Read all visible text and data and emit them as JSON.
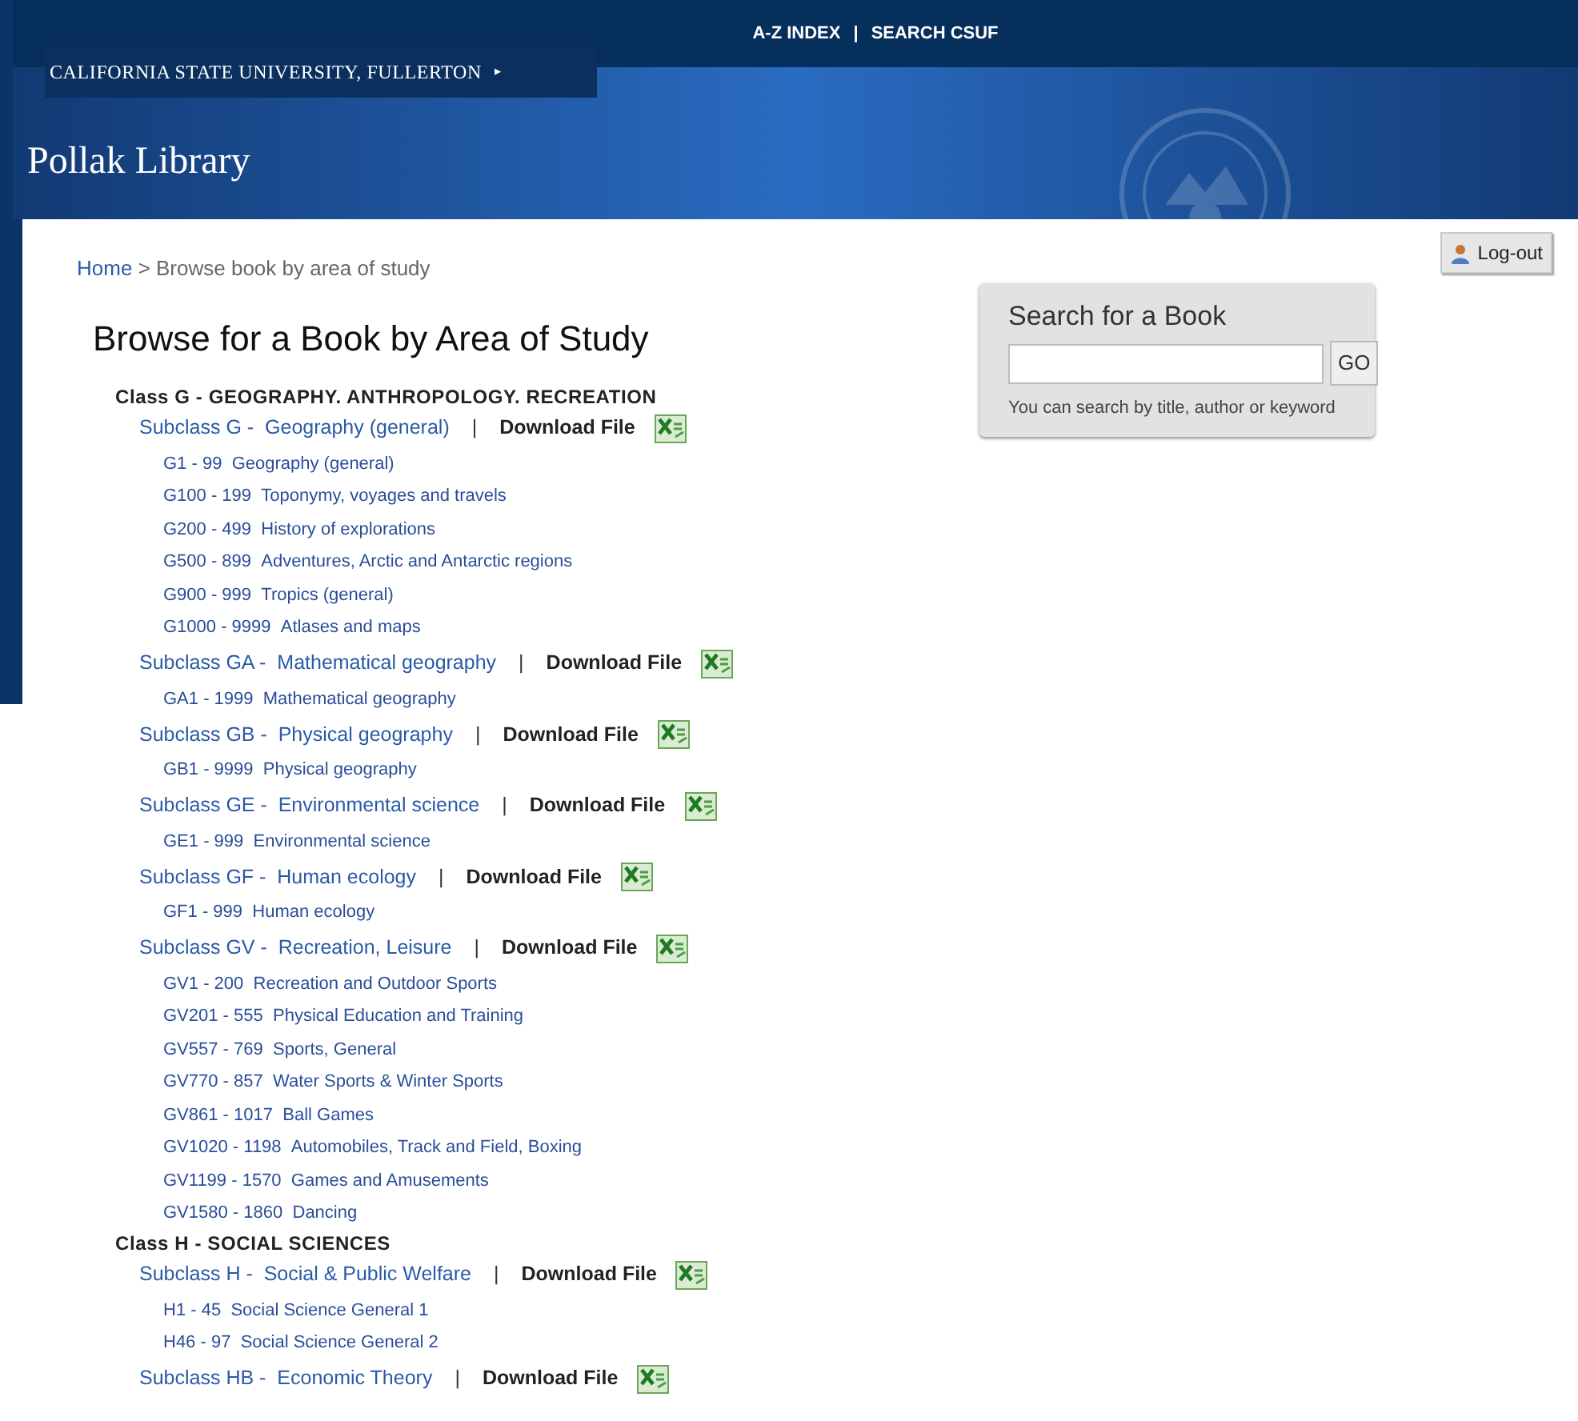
{
  "top_links": [
    "A-Z INDEX",
    "SEARCH CSUF"
  ],
  "link_separator": "|",
  "university": "CALIFORNIA STATE UNIVERSITY, FULLERTON",
  "university_arrow": "▸",
  "site_title": "Pollak Library",
  "breadcrumb": {
    "home": "Home",
    "current": "> Browse book by area of study"
  },
  "logout": "Log-out",
  "search": {
    "title": "Search for a Book",
    "button": "GO",
    "hint": "You can search by title, author or keyword"
  },
  "heading": "Browse for a Book by Area of Study",
  "classes": [
    {
      "label": "Class G - GEOGRAPHY. ANTHROPOLOGY. RECREATION",
      "subclasses": [
        {
          "code": "Subclass G -",
          "name": "Geography (general)",
          "separator": "|",
          "download": "Download File",
          "ranges": [
            {
              "code": "G1 - 99",
              "name": "Geography (general)"
            },
            {
              "code": "G100 - 199",
              "name": "Toponymy, voyages and travels"
            },
            {
              "code": "G200 - 499",
              "name": "History of explorations"
            },
            {
              "code": "G500 - 899",
              "name": "Adventures, Arctic and Antarctic regions"
            },
            {
              "code": "G900 - 999",
              "name": "Tropics (general)"
            },
            {
              "code": "G1000 - 9999",
              "name": "Atlases and maps"
            }
          ]
        },
        {
          "code": "Subclass GA -",
          "name": "Mathematical geography",
          "separator": "|",
          "download": "Download File",
          "ranges": [
            {
              "code": "GA1 - 1999",
              "name": "Mathematical geography"
            }
          ]
        },
        {
          "code": "Subclass GB -",
          "name": "Physical geography",
          "separator": "|",
          "download": "Download File",
          "ranges": [
            {
              "code": "GB1 - 9999",
              "name": "Physical geography"
            }
          ]
        },
        {
          "code": "Subclass GE -",
          "name": "Environmental science",
          "separator": "|",
          "download": "Download File",
          "ranges": [
            {
              "code": "GE1 - 999",
              "name": "Environmental science"
            }
          ]
        },
        {
          "code": "Subclass GF -",
          "name": "Human ecology",
          "separator": "|",
          "download": "Download File",
          "ranges": [
            {
              "code": "GF1 - 999",
              "name": "Human ecology"
            }
          ]
        },
        {
          "code": "Subclass GV -",
          "name": "Recreation, Leisure",
          "separator": "|",
          "download": "Download File",
          "ranges": [
            {
              "code": "GV1 - 200",
              "name": "Recreation and Outdoor Sports"
            },
            {
              "code": "GV201 - 555",
              "name": "Physical Education and Training"
            },
            {
              "code": "GV557 - 769",
              "name": "Sports, General"
            },
            {
              "code": "GV770 - 857",
              "name": "Water Sports & Winter Sports"
            },
            {
              "code": "GV861 - 1017",
              "name": "Ball Games"
            },
            {
              "code": "GV1020 - 1198",
              "name": "Automobiles, Track and Field, Boxing"
            },
            {
              "code": "GV1199 - 1570",
              "name": "Games and Amusements"
            },
            {
              "code": "GV1580 - 1860",
              "name": "Dancing"
            }
          ]
        }
      ]
    },
    {
      "label": "Class H - SOCIAL SCIENCES",
      "subclasses": [
        {
          "code": "Subclass H -",
          "name": "Social & Public Welfare",
          "separator": "|",
          "download": "Download File",
          "ranges": [
            {
              "code": "H1 - 45",
              "name": "Social Science General 1"
            },
            {
              "code": "H46 - 97",
              "name": "Social Science General 2"
            }
          ]
        },
        {
          "code": "Subclass HB -",
          "name": "Economic Theory",
          "separator": "|",
          "download": "Download File"
        }
      ]
    }
  ]
}
